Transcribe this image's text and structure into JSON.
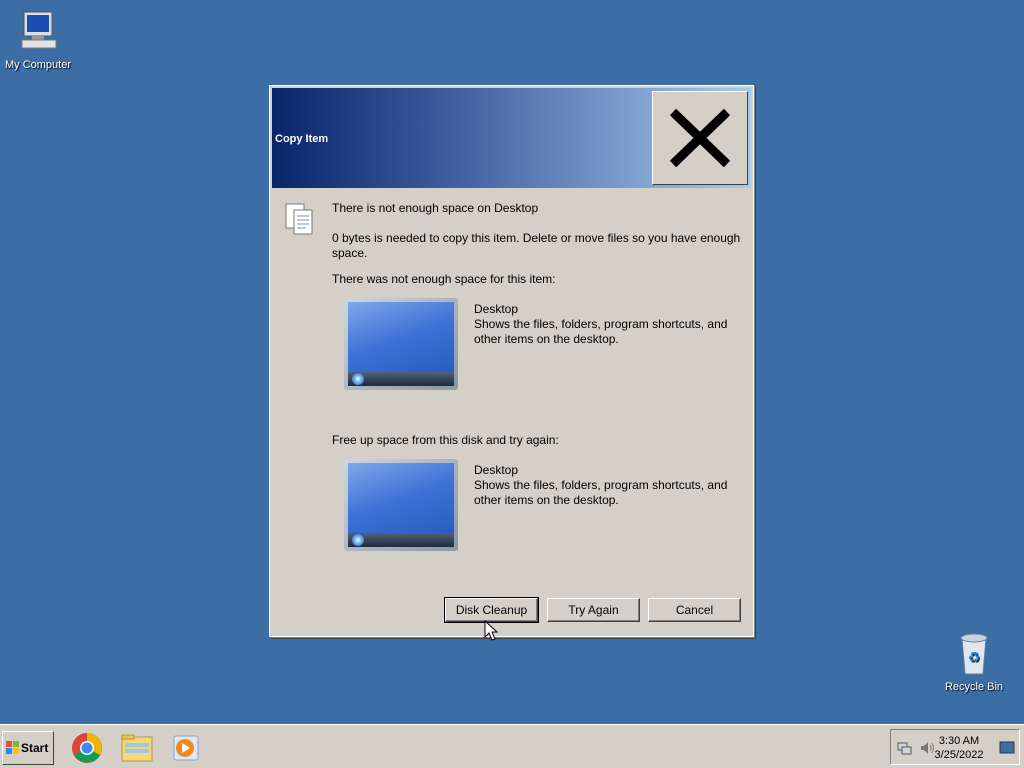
{
  "desktop": {
    "my_computer_label": "My Computer",
    "recycle_bin_label": "Recycle Bin"
  },
  "dialog": {
    "title": "Copy Item",
    "headline": "There is not enough space on Desktop",
    "detail": "0 bytes is needed to copy this item. Delete or move files so you have enough space.",
    "section1_label": "There was not enough space for this item:",
    "item1": {
      "name": "Desktop",
      "description": "Shows the files, folders, program shortcuts, and other items on the desktop."
    },
    "section2_label": "Free up space from this disk and try again:",
    "item2": {
      "name": "Desktop",
      "description": "Shows the files, folders, program shortcuts, and other items on the desktop."
    },
    "buttons": {
      "disk_cleanup": "Disk Cleanup",
      "try_again": "Try Again",
      "cancel": "Cancel"
    }
  },
  "taskbar": {
    "start_label": "Start",
    "pinned": [
      "chrome-icon",
      "file-explorer-icon",
      "media-player-icon"
    ],
    "clock_time": "3:30 AM",
    "clock_date": "3/25/2022"
  }
}
